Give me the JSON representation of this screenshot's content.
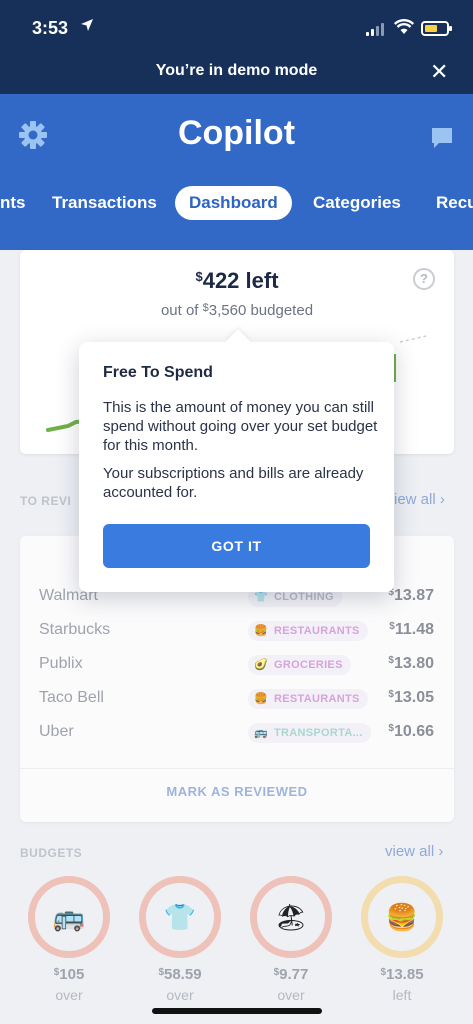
{
  "status_bar": {
    "time": "3:53",
    "location_icon": "location-arrow-icon"
  },
  "demo_bar": {
    "message": "You’re in demo mode",
    "close_label": "✕"
  },
  "header": {
    "title": "Copilot",
    "tabs": [
      {
        "label": "nts"
      },
      {
        "label": "Transactions"
      },
      {
        "label": "Dashboard"
      },
      {
        "label": "Categories"
      },
      {
        "label": "Recu"
      }
    ],
    "active_tab": "Dashboard"
  },
  "spend_card": {
    "currency": "$",
    "amount": "422 left",
    "budgeted_prefix": "out of ",
    "budgeted_value": "3,560 budgeted",
    "help": "?"
  },
  "to_review": {
    "title": "TO REVI",
    "view_all": "iew all ›",
    "transactions": [
      {
        "name": "Walmart",
        "category": "CLOTHING",
        "emoji": "👕",
        "color": "#b9b9c6",
        "amount": "13.87"
      },
      {
        "name": "Starbucks",
        "category": "RESTAURANTS",
        "emoji": "🍔",
        "color": "#d7a3db",
        "amount": "11.48"
      },
      {
        "name": "Publix",
        "category": "GROCERIES",
        "emoji": "🥑",
        "color": "#d7a3db",
        "amount": "13.80"
      },
      {
        "name": "Taco Bell",
        "category": "RESTAURANTS",
        "emoji": "🍔",
        "color": "#d7a3db",
        "amount": "13.05"
      },
      {
        "name": "Uber",
        "category": "TRANSPORTA...",
        "emoji": "🚌",
        "color": "#a9d6d2",
        "amount": "10.66"
      }
    ],
    "mark_reviewed": "MARK AS REVIEWED"
  },
  "budgets": {
    "title": "BUDGETS",
    "view_all": "view all ›",
    "items": [
      {
        "emoji": "🚌",
        "value": "105",
        "label": "over",
        "ring_color": "#e9b3ab"
      },
      {
        "emoji": "👕",
        "value": "58.59",
        "label": "over",
        "ring_color": "#e9b3ab"
      },
      {
        "emoji": "🏖",
        "value": "9.77",
        "label": "over",
        "ring_color": "#e9b3ab"
      },
      {
        "emoji": "🍔",
        "value": "13.85",
        "label": "left",
        "ring_color": "#f1d29a"
      }
    ]
  },
  "tooltip": {
    "title": "Free To Spend",
    "body": "This is the amount of money you can still spend without going over your set budget for this month.",
    "body2": "Your subscriptions and bills are already accounted for.",
    "button": "GOT IT"
  },
  "colors": {
    "header_blue": "#3268c6",
    "dark_navy": "#16305a",
    "button_blue": "#3a7be0"
  }
}
